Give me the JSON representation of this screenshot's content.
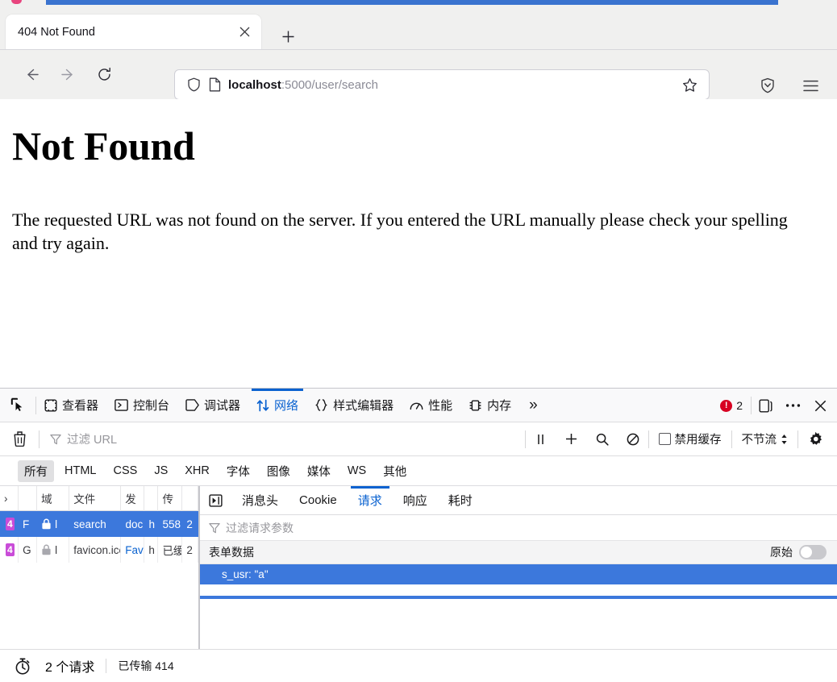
{
  "browser": {
    "tab": {
      "title": "404 Not Found",
      "close_icon": "close-icon"
    },
    "newtab_icon": "plus-icon",
    "nav": {
      "back_icon": "arrow-left-icon",
      "forward_icon": "arrow-right-icon",
      "reload_icon": "reload-icon"
    },
    "url": {
      "host": "localhost",
      "rest": ":5000/user/search",
      "shield_icon": "shield-icon",
      "page_icon": "page-icon",
      "star_icon": "star-icon"
    },
    "toolbar_right": {
      "pocket_icon": "shield-chevron-icon",
      "menu_icon": "hamburger-menu-icon"
    }
  },
  "page": {
    "heading": "Not Found",
    "body": "The requested URL was not found on the server. If you entered the URL manually please check your spelling and try again."
  },
  "devtools": {
    "picker_icon": "element-picker-icon",
    "tabs": [
      {
        "label": "查看器",
        "icon": "inspector-icon",
        "active": false
      },
      {
        "label": "控制台",
        "icon": "console-icon",
        "active": false
      },
      {
        "label": "调试器",
        "icon": "debugger-icon",
        "active": false
      },
      {
        "label": "网络",
        "icon": "network-icon",
        "active": true
      },
      {
        "label": "样式编辑器",
        "icon": "style-editor-icon",
        "active": false
      },
      {
        "label": "性能",
        "icon": "performance-icon",
        "active": false
      },
      {
        "label": "内存",
        "icon": "memory-icon",
        "active": false
      }
    ],
    "overflow_label": "»",
    "error_count": "2",
    "dock_icon": "dock-icon",
    "meatball_icon": "more-options-icon",
    "close_icon": "close-devtools-icon",
    "filterbar": {
      "trash_icon": "clear-requests-icon",
      "filter_placeholder": "过滤 URL",
      "filter_icon": "funnel-icon",
      "pause_icon": "pause-icon",
      "plus_icon": "new-request-icon",
      "search_icon": "search-icon",
      "block_icon": "block-icon",
      "disable_cache_label": "禁用缓存",
      "disable_cache_checked": false,
      "throttle_label": "不节流",
      "gear_icon": "settings-gear-icon"
    },
    "types": [
      {
        "label": "所有",
        "active": true
      },
      {
        "label": "HTML",
        "active": false
      },
      {
        "label": "CSS",
        "active": false
      },
      {
        "label": "JS",
        "active": false
      },
      {
        "label": "XHR",
        "active": false
      },
      {
        "label": "字体",
        "active": false
      },
      {
        "label": "图像",
        "active": false
      },
      {
        "label": "媒体",
        "active": false
      },
      {
        "label": "WS",
        "active": false
      },
      {
        "label": "其他",
        "active": false
      }
    ],
    "request_list": {
      "columns": [
        "›",
        "",
        "域",
        "文件",
        "发",
        "",
        "传",
        ""
      ],
      "rows": [
        {
          "status": "4",
          "method": "F",
          "lock_icon": "lock-icon",
          "domain": "l",
          "file": "search",
          "initiator": "doc",
          "type": "h",
          "transferred": "558",
          "size": "2",
          "selected": true
        },
        {
          "status": "4",
          "method": "G",
          "lock_icon": "lock-icon",
          "domain": "l",
          "file": "favicon.ico",
          "initiator": "Fav",
          "type": "h",
          "transferred": "已缓",
          "size": "2",
          "selected": false
        }
      ]
    },
    "detail": {
      "play_icon": "resend-icon",
      "tabs": [
        {
          "label": "消息头",
          "active": false
        },
        {
          "label": "Cookie",
          "active": false
        },
        {
          "label": "请求",
          "active": true
        },
        {
          "label": "响应",
          "active": false
        },
        {
          "label": "耗时",
          "active": false
        }
      ],
      "filter_placeholder": "过滤请求参数",
      "filter_icon": "funnel-icon",
      "section_label": "表单数据",
      "raw_label": "原始",
      "raw_enabled": false,
      "params": [
        {
          "text": "s_usr: \"a\"",
          "selected": true
        }
      ]
    },
    "statusbar": {
      "timer_icon": "stopwatch-icon",
      "request_count": "2 个请求",
      "transferred": "已传输 414 "
    }
  }
}
